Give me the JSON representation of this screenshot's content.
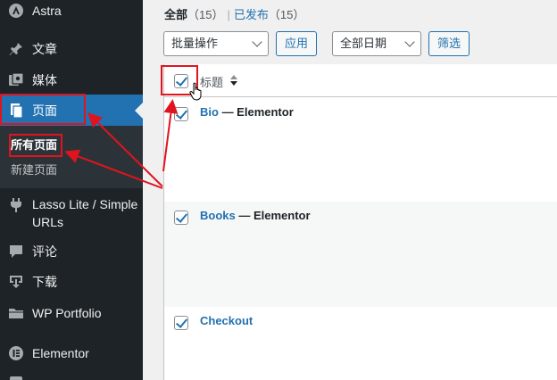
{
  "sidebar": {
    "items": [
      {
        "label": "Astra",
        "icon": "astra-icon"
      },
      {
        "label": "文章",
        "icon": "pin-icon"
      },
      {
        "label": "媒体",
        "icon": "media-icon"
      },
      {
        "label": "页面",
        "icon": "page-icon"
      },
      {
        "label": "Lasso Lite / Simple URLs",
        "icon": "plug-icon"
      },
      {
        "label": "评论",
        "icon": "comment-icon"
      },
      {
        "label": "下载",
        "icon": "download-icon"
      },
      {
        "label": "WP Portfolio",
        "icon": "folder-icon"
      },
      {
        "label": "Elementor",
        "icon": "elementor-icon"
      }
    ],
    "lasso_line1": "Lasso Lite / Simple",
    "lasso_line2": "URLs",
    "submenu": {
      "all_pages": "所有页面",
      "add_new": "新建页面"
    }
  },
  "filters": {
    "all_label": "全部",
    "all_count": "（15）",
    "separator": "|",
    "published_label": "已发布",
    "published_count": "（15）"
  },
  "toolbar": {
    "bulk_actions": "批量操作",
    "apply": "应用",
    "all_dates": "全部日期",
    "filter": "筛选"
  },
  "table": {
    "title_header": "标题",
    "rows": [
      {
        "title": "Bio",
        "state": " — Elementor"
      },
      {
        "title": "Books",
        "state": " — Elementor"
      },
      {
        "title": "Checkout",
        "state": ""
      }
    ]
  },
  "colors": {
    "sidebar_bg": "#1d2327",
    "accent": "#2271b1",
    "annotation": "#e0141e"
  }
}
